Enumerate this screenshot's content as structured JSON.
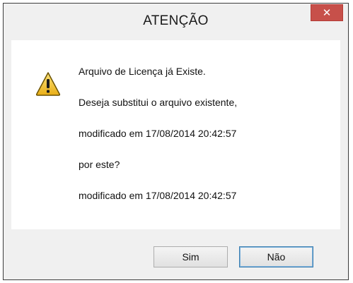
{
  "dialog": {
    "title": "ATENÇÃO",
    "close_glyph": "✕",
    "icon": "warning-icon",
    "messages": [
      "Arquivo de Licença já Existe.",
      "Deseja substitui o arquivo existente,",
      "modificado em 17/08/2014 20:42:57",
      "por este?",
      "modificado em 17/08/2014 20:42:57"
    ],
    "buttons": {
      "yes_label": "Sim",
      "no_label": "Não"
    }
  },
  "colors": {
    "close_button": "#c7504a",
    "warning_fill": "#f2c233",
    "warning_outline": "#6b5200"
  }
}
